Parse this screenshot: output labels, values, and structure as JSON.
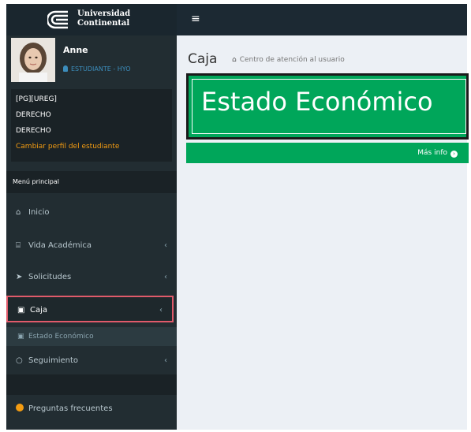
{
  "header": {
    "logo_line1": "Universidad",
    "logo_line2": "Continental",
    "menu_toggle": "≡"
  },
  "user": {
    "name": "Anne",
    "role": "ESTUDIANTE - HYO"
  },
  "profile": {
    "line1": "[PG][UREG]",
    "line2": "DERECHO",
    "line3": "DERECHO",
    "change_link": "Cambiar perfil del estudiante"
  },
  "menu": {
    "header": "Menú principal",
    "items": [
      {
        "label": "Inicio",
        "icon": "home-icon"
      },
      {
        "label": "Vida Académica",
        "icon": "bank-icon"
      },
      {
        "label": "Solicitudes",
        "icon": "paper-plane-icon"
      },
      {
        "label": "Caja",
        "icon": "money-icon"
      },
      {
        "label": "Seguimiento",
        "icon": "circle-notch-icon"
      }
    ],
    "submenu": {
      "label": "Estado Económico",
      "icon": "money-icon"
    },
    "faq": {
      "label": "Preguntas frecuentes",
      "icon": "question-circle-icon"
    }
  },
  "content": {
    "title": "Caja",
    "breadcrumb": "Centro de atención al usuario",
    "box_title": "Estado Económico",
    "box_link": "Más info"
  },
  "colors": {
    "sidebar": "#222d32",
    "topbar": "#1c2933",
    "accent_green": "#00a65a",
    "highlight_border": "#e05a6a",
    "warning": "#f39c12"
  }
}
